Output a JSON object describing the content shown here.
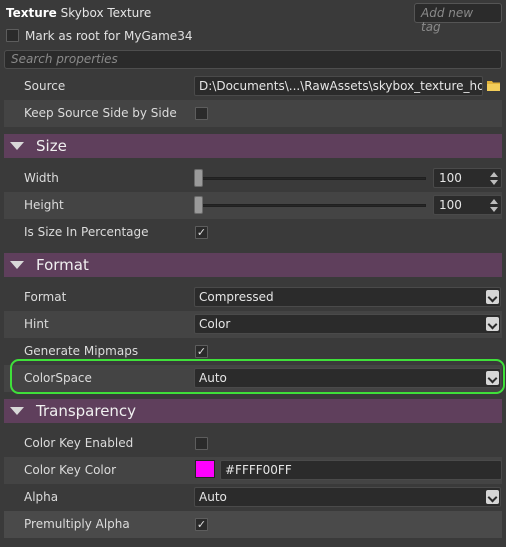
{
  "header": {
    "type_label": "Texture",
    "asset_name": "Skybox Texture",
    "tag_placeholder": "Add new tag",
    "mark_root_label": "Mark as root for MyGame34",
    "search_placeholder": "Search properties"
  },
  "properties": {
    "source_label": "Source",
    "source_value": "D:\\Documents\\...\\RawAssets\\skybox_texture_hdr.dds",
    "keep_source_label": "Keep Source Side by Side"
  },
  "size": {
    "title": "Size",
    "width_label": "Width",
    "width_value": "100",
    "height_label": "Height",
    "height_value": "100",
    "percentage_label": "Is Size In Percentage"
  },
  "format": {
    "title": "Format",
    "format_label": "Format",
    "format_value": "Compressed",
    "hint_label": "Hint",
    "hint_value": "Color",
    "mipmaps_label": "Generate Mipmaps",
    "colorspace_label": "ColorSpace",
    "colorspace_value": "Auto"
  },
  "transparency": {
    "title": "Transparency",
    "colorkey_enabled_label": "Color Key Enabled",
    "colorkey_color_label": "Color Key Color",
    "colorkey_color_value": "#FFFF00FF",
    "alpha_label": "Alpha",
    "alpha_value": "Auto",
    "premultiply_label": "Premultiply Alpha"
  },
  "colors": {
    "section_header": "#5f3f5c",
    "highlight": "#3fe03a",
    "color_key_swatch": "#ff00ff"
  },
  "icons": {
    "folder": "folder-icon",
    "checkmark": "checkmark-icon",
    "collapse": "triangle-down-icon"
  }
}
